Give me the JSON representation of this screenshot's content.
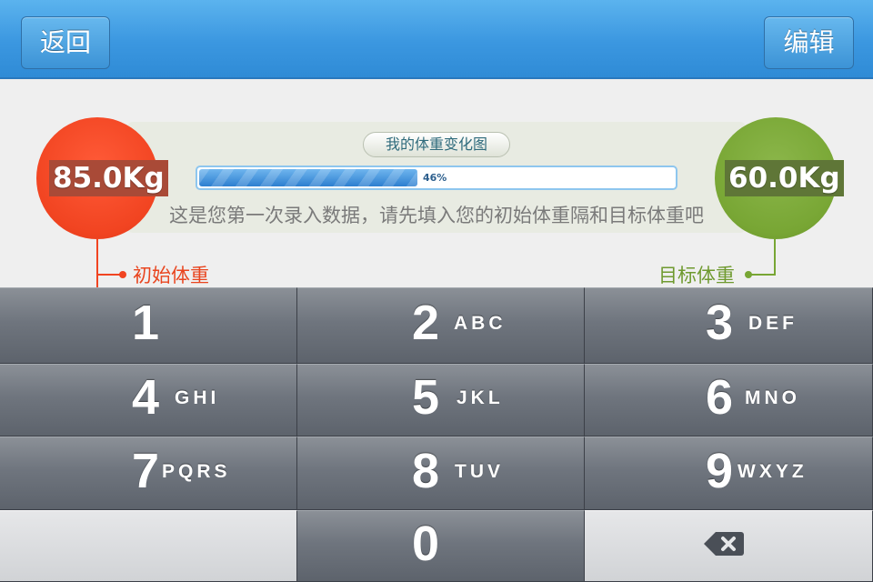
{
  "nav": {
    "back_label": "返回",
    "edit_label": "编辑"
  },
  "chart": {
    "title": "我的体重变化图",
    "progress": 0.46,
    "progress_label": "46%",
    "hint": "这是您第一次录入数据，请先填入您的初始体重隔和目标体重吧"
  },
  "start_weight": {
    "value": "85.0Kg",
    "label": "初始体重",
    "color": "#f14421"
  },
  "target_weight": {
    "value": "60.0Kg",
    "label": "目标体重",
    "color": "#78a634"
  },
  "keypad": {
    "keys": [
      {
        "digit": "1",
        "letters": ""
      },
      {
        "digit": "2",
        "letters": "ABC"
      },
      {
        "digit": "3",
        "letters": "DEF"
      },
      {
        "digit": "4",
        "letters": "GHI"
      },
      {
        "digit": "5",
        "letters": "JKL"
      },
      {
        "digit": "6",
        "letters": "MNO"
      },
      {
        "digit": "7",
        "letters": "PQRS"
      },
      {
        "digit": "8",
        "letters": "TUV"
      },
      {
        "digit": "9",
        "letters": "WXYZ"
      },
      {
        "digit": "0",
        "letters": ""
      }
    ],
    "delete_icon": "backspace-icon"
  },
  "colors": {
    "nav_blue": "#3b97e0",
    "key_gray": "#6f757e"
  }
}
